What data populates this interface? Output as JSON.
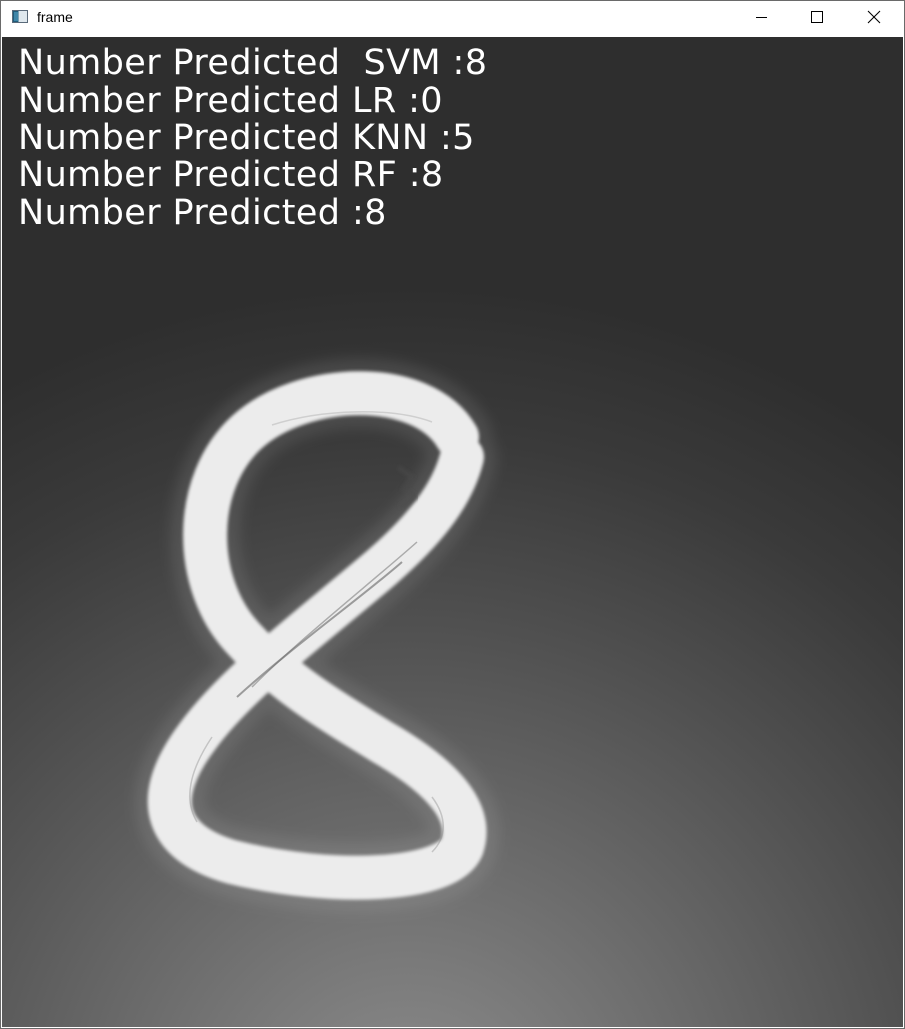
{
  "window": {
    "title": "frame",
    "icons": {
      "app": "opencv-window-icon",
      "minimize": "minimize-icon",
      "maximize": "maximize-icon",
      "close": "close-icon"
    }
  },
  "predictions": [
    {
      "model": "SVM",
      "text": "Number Predicted  SVM :8",
      "value": "8"
    },
    {
      "model": "LR",
      "text": "Number Predicted LR :0",
      "value": "0"
    },
    {
      "model": "KNN",
      "text": "Number Predicted KNN :5",
      "value": "5"
    },
    {
      "model": "RF",
      "text": "Number Predicted RF :8",
      "value": "8"
    },
    {
      "model": "",
      "text": "Number Predicted :8",
      "value": "8"
    }
  ],
  "colors": {
    "overlay_text": "#ffffff",
    "digit": "#eeeeee"
  }
}
